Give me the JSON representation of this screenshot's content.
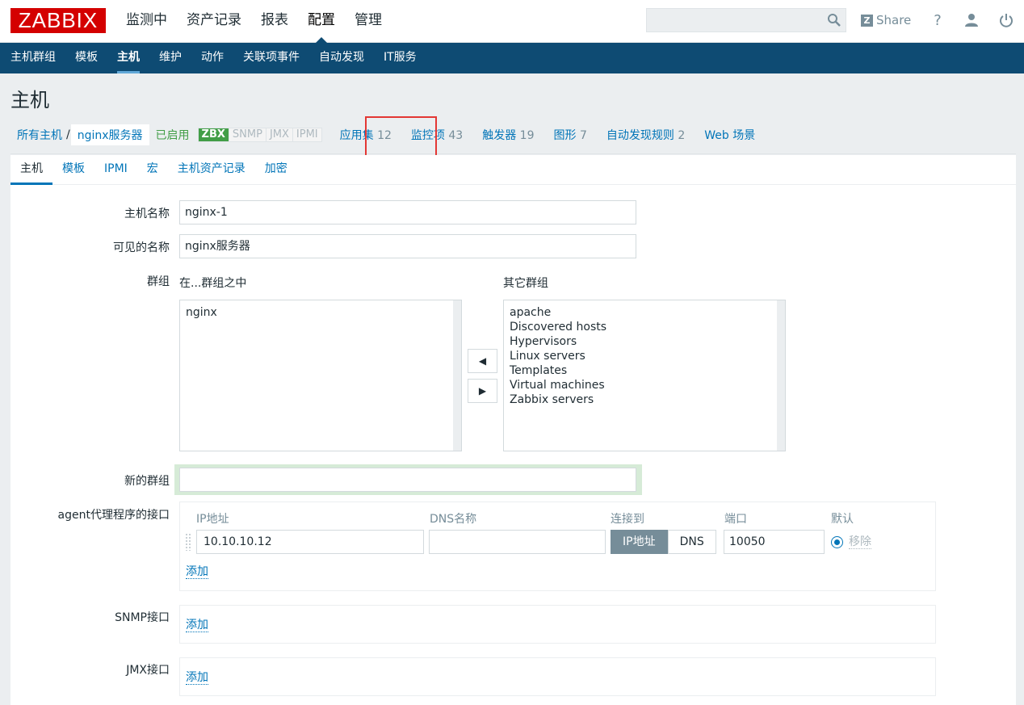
{
  "header": {
    "logo": "ZABBIX",
    "main_nav": [
      "监测中",
      "资产记录",
      "报表",
      "配置",
      "管理"
    ],
    "share": "Share",
    "help": "?"
  },
  "subnav": [
    "主机群组",
    "模板",
    "主机",
    "维护",
    "动作",
    "关联项事件",
    "自动发现",
    "IT服务"
  ],
  "page_title": "主机",
  "breadcrumb": {
    "all_hosts": "所有主机",
    "sep": "/",
    "current": "nginx服务器",
    "status": "已启用",
    "availability": [
      "ZBX",
      "SNMP",
      "JMX",
      "IPMI"
    ],
    "links": [
      {
        "label": "应用集",
        "count": "12"
      },
      {
        "label": "监控项",
        "count": "43"
      },
      {
        "label": "触发器",
        "count": "19"
      },
      {
        "label": "图形",
        "count": "7"
      },
      {
        "label": "自动发现规则",
        "count": "2"
      },
      {
        "label": "Web 场景",
        "count": ""
      }
    ]
  },
  "tabs": [
    "主机",
    "模板",
    "IPMI",
    "宏",
    "主机资产记录",
    "加密"
  ],
  "form": {
    "host_name_label": "主机名称",
    "host_name": "nginx-1",
    "visible_name_label": "可见的名称",
    "visible_name": "nginx服务器",
    "groups_label": "群组",
    "in_groups_title": "在...群组之中",
    "other_groups_title": "其它群组",
    "in_groups": [
      "nginx"
    ],
    "other_groups": [
      "apache",
      "Discovered hosts",
      "Hypervisors",
      "Linux servers",
      "Templates",
      "Virtual machines",
      "Zabbix servers"
    ],
    "new_group_label": "新的群组",
    "new_group": "",
    "agent_label": "agent代理程序的接口",
    "iface_headers": {
      "ip": "IP地址",
      "dns": "DNS名称",
      "connect": "连接到",
      "port": "端口",
      "default": "默认"
    },
    "ip": "10.10.10.12",
    "dns": "",
    "connect_ip": "IP地址",
    "connect_dns": "DNS",
    "port": "10050",
    "remove": "移除",
    "add": "添加",
    "snmp_label": "SNMP接口",
    "jmx_label": "JMX接口"
  },
  "colors": {
    "logo": "#d40000",
    "subnav": "#0e4b73",
    "link": "#0275b8",
    "enabled": "#429e47",
    "highlight": "#e33734"
  }
}
